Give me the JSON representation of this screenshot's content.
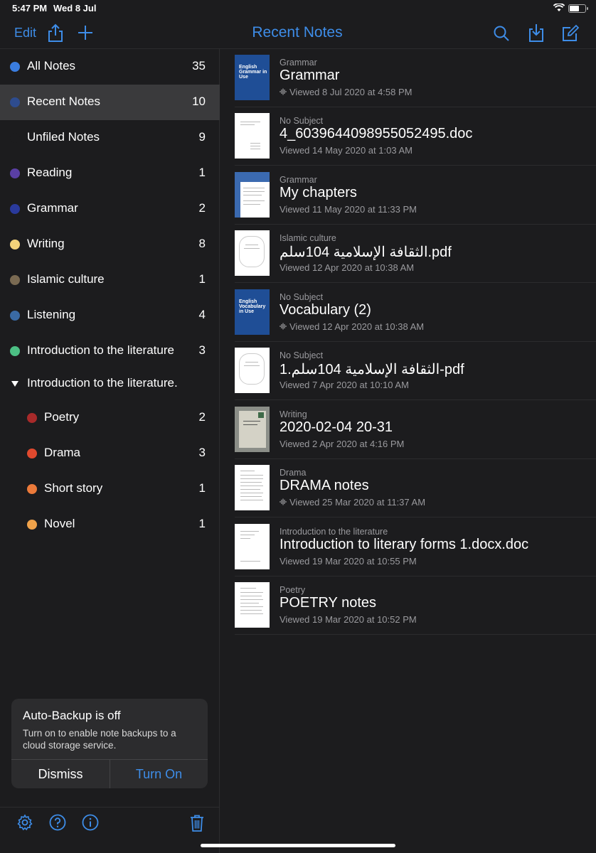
{
  "status": {
    "time": "5:47 PM",
    "date": "Wed 8 Jul"
  },
  "nav": {
    "edit_label": "Edit",
    "title": "Recent Notes",
    "icons": [
      "share-icon",
      "add-icon",
      "search-icon",
      "import-icon",
      "compose-icon"
    ]
  },
  "sidebar": {
    "items": [
      {
        "label": "All Notes",
        "count": "35",
        "color": "#3a7de0"
      },
      {
        "label": "Recent Notes",
        "count": "10",
        "color": "#2e4c8e"
      },
      {
        "label": "Unfiled Notes",
        "count": "9",
        "color": "#1c1c1e"
      },
      {
        "label": "Reading",
        "count": "1",
        "color": "#5a3fa4"
      },
      {
        "label": "Grammar",
        "count": "2",
        "color": "#2a3a9c"
      },
      {
        "label": "Writing",
        "count": "8",
        "color": "#f2d27a"
      },
      {
        "label": "Islamic culture",
        "count": "1",
        "color": "#7a6a52"
      },
      {
        "label": "Listening",
        "count": "4",
        "color": "#3a6aa4"
      },
      {
        "label": "Introduction to the literature",
        "count": "3",
        "color": "#4cbf84"
      },
      {
        "label": "Introduction to the literature."
      },
      {
        "label": "Poetry",
        "count": "2",
        "color": "#a82a2a"
      },
      {
        "label": "Drama",
        "count": "3",
        "color": "#e0492e"
      },
      {
        "label": "Short story",
        "count": "1",
        "color": "#ec7a3a"
      },
      {
        "label": "Novel",
        "count": "1",
        "color": "#f0a24a"
      }
    ]
  },
  "backup": {
    "title": "Auto-Backup is off",
    "body": "Turn on to enable note backups to a cloud storage service.",
    "dismiss_label": "Dismiss",
    "turn_on_label": "Turn On"
  },
  "toolbar_icons": [
    "settings-icon",
    "help-icon",
    "info-icon",
    "trash-icon"
  ],
  "notes": [
    {
      "subject": "Grammar",
      "title": "Grammar",
      "viewed": "Viewed 8 Jul 2020 at 4:58 PM",
      "audio": true,
      "thumb": "blue",
      "thumb_text": "English Grammar in Use"
    },
    {
      "subject": "No Subject",
      "title": "4_6039644098955052495.doc",
      "viewed": "Viewed 14 May 2020 at 1:03 AM",
      "audio": false,
      "thumb": "doc"
    },
    {
      "subject": "Grammar",
      "title": "My chapters",
      "viewed": "Viewed 11 May 2020 at 11:33 PM",
      "audio": false,
      "thumb": "doc"
    },
    {
      "subject": "Islamic culture",
      "title": "الثقافة الإسلامية 104سلم.pdf",
      "viewed": "Viewed 12 Apr 2020 at 10:38 AM",
      "audio": false,
      "thumb": "doc"
    },
    {
      "subject": "No Subject",
      "title": "Vocabulary (2)",
      "viewed": "Viewed 12 Apr 2020 at 10:38 AM",
      "audio": true,
      "thumb": "blue",
      "thumb_text": "English Vocabulary in Use"
    },
    {
      "subject": "No Subject",
      "title": "الثقافة الإسلامية 104سلم.1-pdf",
      "viewed": "Viewed 7 Apr 2020 at 10:10 AM",
      "audio": false,
      "thumb": "doc"
    },
    {
      "subject": "Writing",
      "title": "2020-02-04 20-31",
      "viewed": "Viewed 2 Apr 2020 at 4:16 PM",
      "audio": false,
      "thumb": "photo"
    },
    {
      "subject": "Drama",
      "title": "DRAMA notes",
      "viewed": "Viewed 25 Mar 2020 at 11:37 AM",
      "audio": true,
      "thumb": "doc"
    },
    {
      "subject": "Introduction to the literature",
      "title": "Introduction to literary forms 1.docx.doc",
      "viewed": "Viewed 19 Mar 2020 at 10:55 PM",
      "audio": false,
      "thumb": "doc"
    },
    {
      "subject": "Poetry",
      "title": "POETRY notes",
      "viewed": "Viewed 19 Mar 2020 at 10:52 PM",
      "audio": false,
      "thumb": "doc"
    }
  ]
}
